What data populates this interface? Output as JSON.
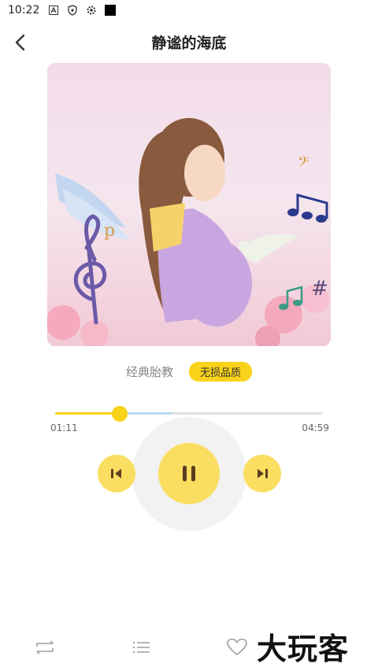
{
  "status_bar": {
    "time": "10:22"
  },
  "header": {
    "title": "静谧的海底"
  },
  "track": {
    "category": "经典胎教",
    "quality_badge": "无损品质",
    "current_time": "01:11",
    "total_time": "04:59",
    "played_fraction": 0.24,
    "buffered_fraction": 0.44
  },
  "colors": {
    "accent": "#f9d21a",
    "button_bg": "#fade62",
    "buffer": "#b9dcf2"
  },
  "controls": {
    "prev_icon": "skip-previous-icon",
    "play_icon": "pause-icon",
    "next_icon": "skip-next-icon"
  },
  "bottom_bar": {
    "icons": [
      "repeat-icon",
      "playlist-icon",
      "heart-icon"
    ]
  },
  "watermark": {
    "text": "大玩客"
  }
}
